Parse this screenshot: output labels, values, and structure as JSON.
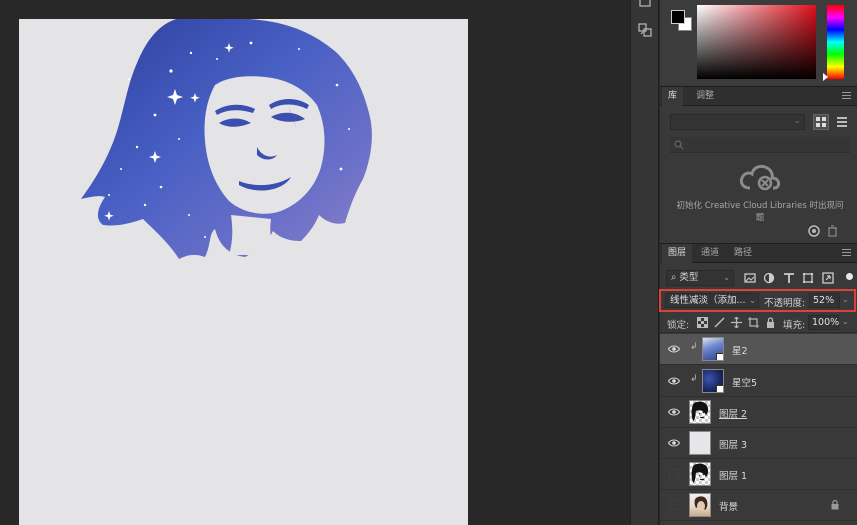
{
  "color_panel": {
    "foreground": "#000000",
    "background": "#ffffff",
    "hue": "#e0101c"
  },
  "library_panel": {
    "tabs": [
      {
        "label": "库",
        "active": true
      },
      {
        "label": "调整",
        "active": false
      }
    ],
    "message": "初始化 Creative Cloud Libraries 时出现问题"
  },
  "layers_panel": {
    "tabs": [
      {
        "label": "图层",
        "active": true
      },
      {
        "label": "通道",
        "active": false
      },
      {
        "label": "路径",
        "active": false
      }
    ],
    "kind_filter": "类型",
    "blend_mode": "线性减淡（添加...",
    "opacity_label": "不透明度:",
    "opacity_value": "52%",
    "lock_label": "锁定:",
    "fill_label": "填充:",
    "fill_value": "100%",
    "layers": [
      {
        "name": "星2",
        "visible": true,
        "selected": true,
        "clipped": true,
        "thumb": "galaxy",
        "smart": true
      },
      {
        "name": "星空5",
        "visible": true,
        "selected": false,
        "clipped": true,
        "thumb": "galaxy-dark",
        "smart": true
      },
      {
        "name": "图层 2",
        "visible": true,
        "selected": false,
        "clipped": false,
        "thumb": "portrait",
        "underline": true
      },
      {
        "name": "图层 3",
        "visible": true,
        "selected": false,
        "clipped": false,
        "thumb": "blank"
      },
      {
        "name": "图层 1",
        "visible": false,
        "selected": false,
        "clipped": false,
        "thumb": "portrait"
      },
      {
        "name": "背景",
        "visible": false,
        "selected": false,
        "clipped": false,
        "thumb": "photo",
        "locked": true
      }
    ]
  },
  "canvas": {
    "background": "#e4e4e6",
    "galaxy_colors": [
      "#2b3f9e",
      "#4960c4",
      "#6a6fc8",
      "#8c83c9"
    ]
  }
}
